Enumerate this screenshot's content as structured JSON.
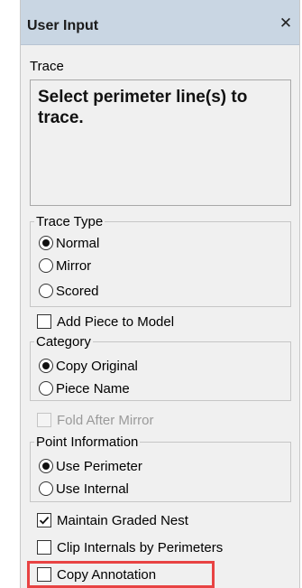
{
  "dialog": {
    "title": "User Input",
    "close_glyph": "✕"
  },
  "trace": {
    "label": "Trace",
    "instruction": "Select perimeter line(s) to trace."
  },
  "trace_type": {
    "label": "Trace Type",
    "options": [
      {
        "label": "Normal",
        "selected": true
      },
      {
        "label": "Mirror",
        "selected": false
      },
      {
        "label": "Scored",
        "selected": false
      }
    ]
  },
  "add_piece": {
    "label": "Add Piece to Model",
    "checked": false
  },
  "category": {
    "label": "Category",
    "options": [
      {
        "label": "Copy Original",
        "selected": true
      },
      {
        "label": "Piece Name",
        "selected": false
      }
    ]
  },
  "fold_after_mirror": {
    "label": "Fold After Mirror",
    "checked": false,
    "enabled": false
  },
  "point_information": {
    "label": "Point Information",
    "options": [
      {
        "label": "Use Perimeter",
        "selected": true
      },
      {
        "label": "Use Internal",
        "selected": false
      }
    ]
  },
  "maintain_graded_nest": {
    "label": "Maintain Graded Nest",
    "checked": true
  },
  "clip_internals": {
    "label": "Clip Internals by Perimeters",
    "checked": false
  },
  "copy_annotation": {
    "label": "Copy Annotation",
    "checked": false,
    "highlight_color": "#e84343"
  },
  "colors": {
    "titlebar": "#c9d6e3",
    "panel": "#f0f0f0"
  }
}
